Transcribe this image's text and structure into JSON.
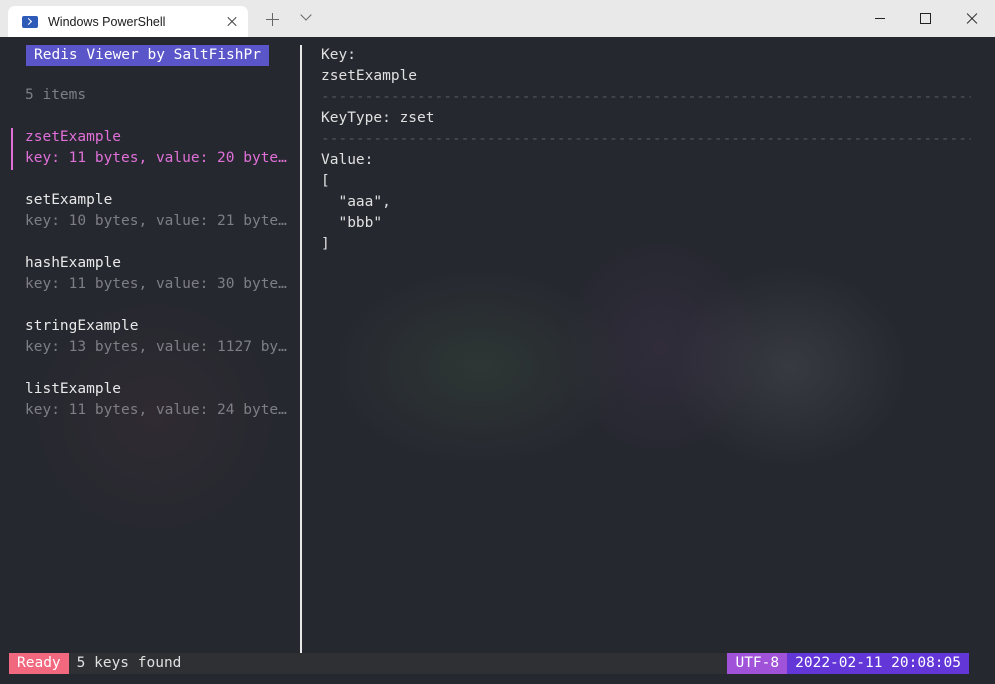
{
  "window": {
    "tab_title": "Windows PowerShell"
  },
  "app": {
    "title": "Redis Viewer by SaltFishPr",
    "item_count": "5 items",
    "keys": [
      {
        "name": "zsetExample",
        "meta": "key: 11 bytes, value: 20 byte…",
        "selected": true
      },
      {
        "name": "setExample",
        "meta": "key: 10 bytes, value: 21 byte…",
        "selected": false
      },
      {
        "name": "hashExample",
        "meta": "key: 11 bytes, value: 30 byte…",
        "selected": false
      },
      {
        "name": "stringExample",
        "meta": "key: 13 bytes, value: 1127 by…",
        "selected": false
      },
      {
        "name": "listExample",
        "meta": "key: 11 bytes, value: 24 byte…",
        "selected": false
      }
    ]
  },
  "detail": {
    "key_label": "Key:",
    "key_value": "zsetExample",
    "separator": "-----------------------------------------------------------------------------------",
    "keytype_line": "KeyType: zset",
    "value_label": "Value:",
    "value_lines": [
      "[",
      "  \"aaa\",",
      "  \"bbb\"",
      "]"
    ]
  },
  "status": {
    "state": "Ready",
    "message": "5 keys found",
    "encoding": "UTF-8",
    "datetime": "2022-02-11 20:08:05"
  },
  "colors": {
    "accent_pink": "#e070d8",
    "title_bg": "#5a55c8",
    "ready_bg": "#f2687e",
    "encoding_bg": "#a052d8",
    "time_bg": "#6336d8"
  }
}
